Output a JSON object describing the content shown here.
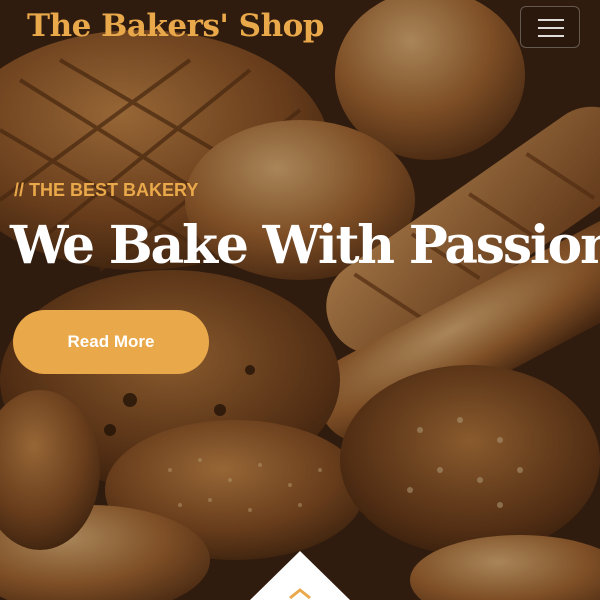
{
  "navbar": {
    "brand": "The Bakers' Shop",
    "toggler_icon": "hamburger-menu-icon"
  },
  "hero": {
    "subtitle": "// THE BEST BAKERY",
    "headline": "We Bake With Passion",
    "cta_label": "Read More",
    "scroll_icon": "chevron-down-icon"
  },
  "colors": {
    "accent": "#e9a84a",
    "headline": "#ffffff",
    "background_overlay": "#3a2211"
  }
}
